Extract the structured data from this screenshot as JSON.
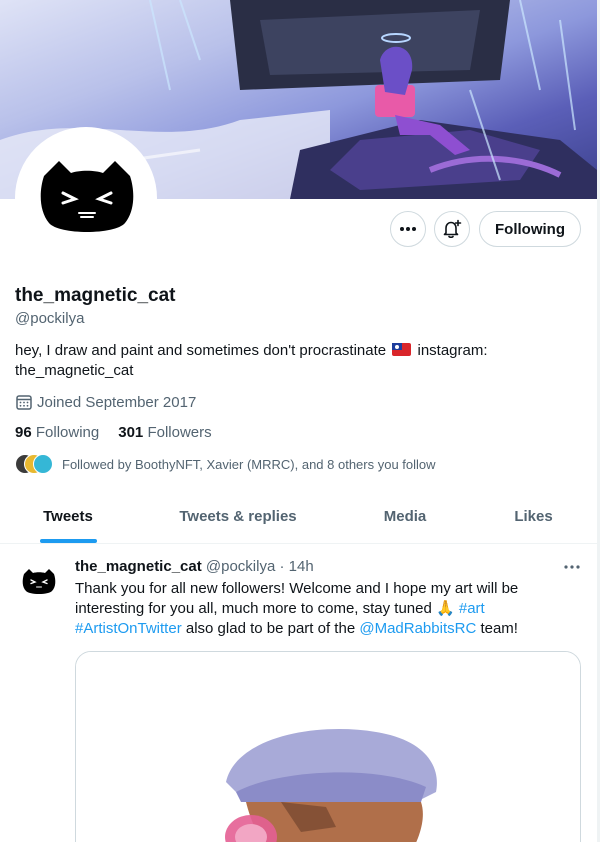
{
  "profile": {
    "display_name": "the_magnetic_cat",
    "handle": "@pockilya",
    "bio_part1": "hey, I draw and paint and sometimes don't procrastinate",
    "bio_part2": "instagram: the_magnetic_cat",
    "joined": "Joined September 2017",
    "following_count": "96",
    "following_label": "Following",
    "followers_count": "301",
    "followers_label": "Followers",
    "followed_by": "Followed by BoothyNFT, Xavier (MRRC), and 8 others you follow"
  },
  "actions": {
    "more_icon": "ellipsis-icon",
    "notify_icon": "bell-plus-icon",
    "following_button": "Following"
  },
  "tabs": [
    "Tweets",
    "Tweets & replies",
    "Media",
    "Likes"
  ],
  "active_tab": "Tweets",
  "tweet": {
    "name": "the_magnetic_cat",
    "handle": "@pockilya",
    "separator": "·",
    "time": "14h",
    "text_before": "Thank you for all new followers! Welcome and I hope my art will be interesting for you all, much more to come, stay tuned",
    "emoji": "🙏",
    "hashtag1": "#art",
    "hashtag2": "#ArtistOnTwitter",
    "text_middle": "also glad to be part of the",
    "mention": "@MadRabbitsRC",
    "text_end": "team!"
  },
  "colors": {
    "accent": "#1d9bf0",
    "secondary_text": "#536471",
    "border": "#cfd9de"
  }
}
